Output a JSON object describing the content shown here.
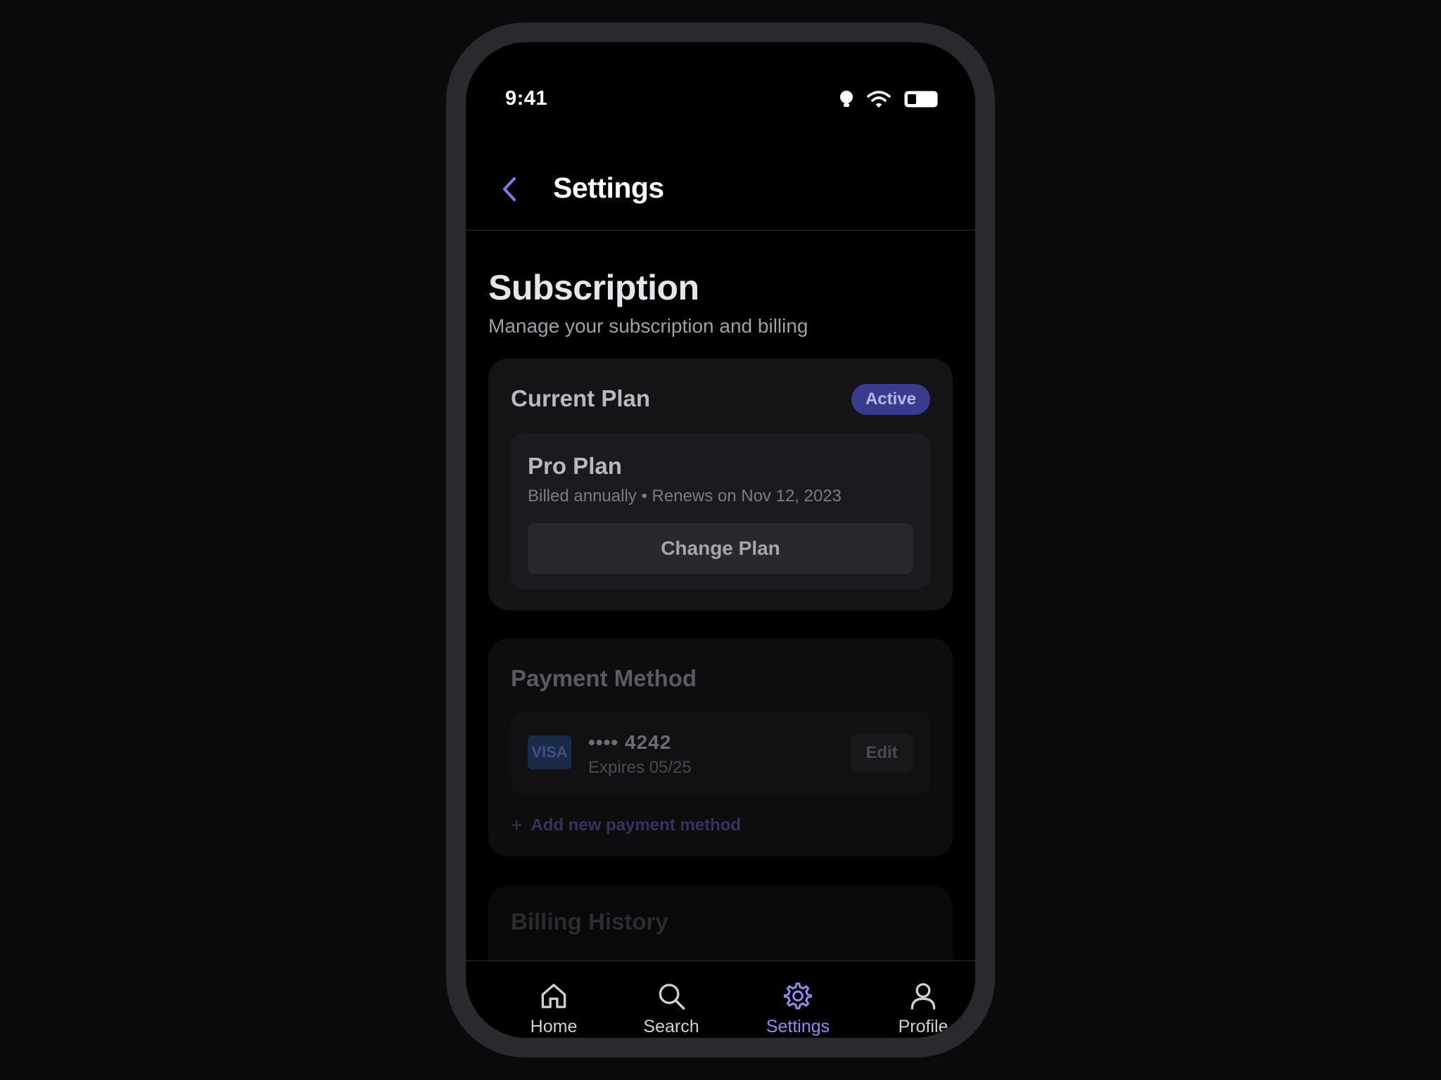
{
  "status_bar": {
    "time": "9:41"
  },
  "header": {
    "title": "Settings"
  },
  "page": {
    "title": "Subscription",
    "subtitle": "Manage your subscription and billing"
  },
  "current_plan": {
    "title": "Current Plan",
    "badge": "Active",
    "plan_name": "Pro Plan",
    "plan_meta": "Billed annually • Renews on Nov 12, 2023",
    "change_button": "Change Plan"
  },
  "payment_method": {
    "title": "Payment Method",
    "card_brand": "VISA",
    "card_number": "•••• 4242",
    "card_expiry": "Expires 05/25",
    "edit_button": "Edit",
    "add_plus": "+",
    "add_label": "Add new payment method"
  },
  "billing_history": {
    "title": "Billing History"
  },
  "tab_bar": {
    "items": [
      {
        "label": "Home",
        "icon": "home-icon"
      },
      {
        "label": "Search",
        "icon": "search-icon"
      },
      {
        "label": "Settings",
        "icon": "gear-icon",
        "active": true
      },
      {
        "label": "Profile",
        "icon": "user-icon"
      }
    ]
  },
  "colors": {
    "accent": "#8f8ff0",
    "badge_bg": "#3a3a8f",
    "background": "#000000",
    "frame": "#2a2a2e"
  }
}
